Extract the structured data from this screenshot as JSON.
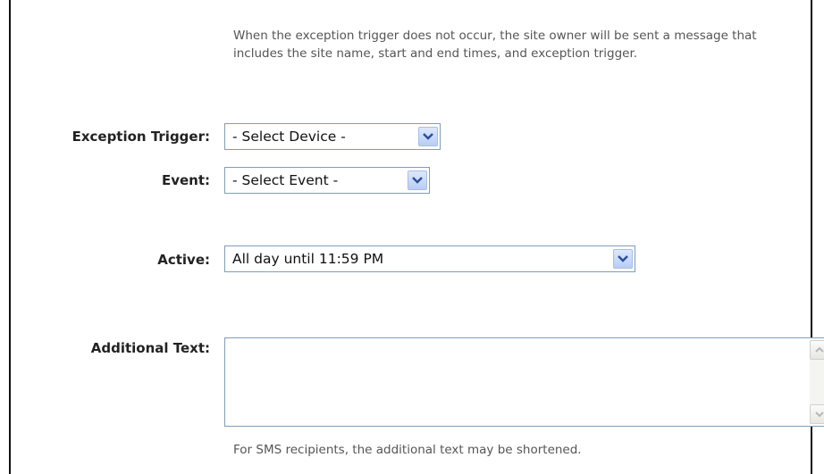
{
  "intro_text": "When the exception trigger does not occur, the site owner will be sent a message that includes the site name, start and end times, and exception trigger.",
  "fields": {
    "exception_trigger": {
      "label": "Exception Trigger:",
      "value": "- Select Device -"
    },
    "event": {
      "label": "Event:",
      "value": "- Select Event -"
    },
    "active": {
      "label": "Active:",
      "value": "All day until 11:59 PM"
    },
    "additional_text": {
      "label": "Additional Text:",
      "value": ""
    }
  },
  "sms_note": "For SMS recipients, the additional text may be shortened.",
  "icons": {
    "dropdown": "chevron-down-icon",
    "scroll_up": "scroll-up-arrow-icon",
    "scroll_down": "scroll-down-arrow-icon"
  },
  "colors": {
    "input_border": "#7f9db9",
    "dropdown_button": "#b8cdf6",
    "dropdown_arrow": "#2c4e9c"
  }
}
